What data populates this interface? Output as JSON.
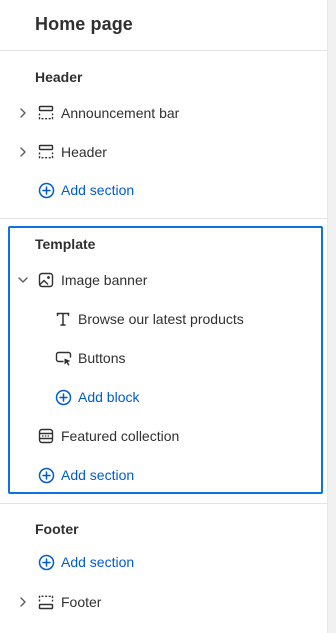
{
  "page": {
    "title": "Home page"
  },
  "header_group": {
    "heading": "Header",
    "items": [
      {
        "label": "Announcement bar",
        "icon": "section-icon"
      },
      {
        "label": "Header",
        "icon": "section-icon"
      }
    ],
    "add_label": "Add section"
  },
  "template_group": {
    "heading": "Template",
    "section": {
      "label": "Image banner",
      "icon": "image-icon",
      "expanded": true
    },
    "blocks": [
      {
        "label": "Browse our latest products",
        "icon": "text-icon"
      },
      {
        "label": "Buttons",
        "icon": "button-icon"
      }
    ],
    "add_block_label": "Add block",
    "section2": {
      "label": "Featured collection",
      "icon": "collection-icon"
    },
    "add_label": "Add section"
  },
  "footer_group": {
    "heading": "Footer",
    "add_label": "Add section",
    "items": [
      {
        "label": "Footer",
        "icon": "footer-icon"
      }
    ]
  },
  "colors": {
    "accent": "#005bd3",
    "highlight_border": "#0b74e0",
    "text": "#303030"
  }
}
